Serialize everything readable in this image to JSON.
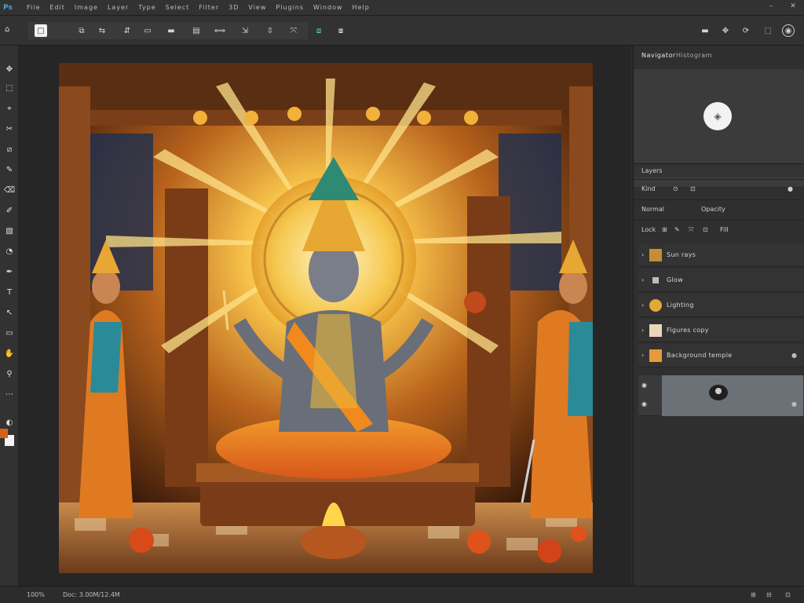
{
  "menubar": {
    "logo": "Ps",
    "items": [
      "File",
      "Edit",
      "Image",
      "Layer",
      "Type",
      "Select",
      "Filter",
      "3D",
      "View",
      "Plugins",
      "Window",
      "Help"
    ],
    "controls": [
      "–",
      "✕"
    ]
  },
  "optionsbar": {
    "preset_icon": "move-tool-icon",
    "buttons": [
      "▢",
      "⧉",
      "⇆",
      "⇵",
      "▭",
      "▬",
      "▤",
      "⟺",
      "⇲",
      "⇳",
      "⤧",
      "⧈"
    ],
    "right_buttons": [
      "▬",
      "✥",
      "⟳",
      "◉"
    ]
  },
  "toolbar": {
    "tools": [
      "✥",
      "⬚",
      "⌖",
      "✂",
      "⧄",
      "✎",
      "⌫",
      "✐",
      "▧",
      "◔",
      "✒",
      "T",
      "↖",
      "▭",
      "✋",
      "⚲",
      "⋯"
    ]
  },
  "panels": {
    "tabs": [
      "Navigator",
      "Histogram"
    ],
    "layers_header": "Layers",
    "layers_toolbar": [
      "Kind",
      "⊙",
      "⊡"
    ],
    "blend": {
      "mode": "Normal",
      "opacity": "Opacity"
    },
    "lock_row": [
      "Lock",
      "⊞",
      "✎",
      "⤧",
      "⊡",
      "Fill"
    ],
    "layers": [
      {
        "name": "Sun rays"
      },
      {
        "name": "Glow"
      },
      {
        "name": "Lighting"
      },
      {
        "name": "Figures copy"
      },
      {
        "name": "Background temple"
      }
    ]
  },
  "statusbar": {
    "zoom": "100%",
    "info": "Doc: 3.00M/12.4M",
    "right_icons": [
      "⊞",
      "⊟",
      "⊡"
    ]
  },
  "colors": {
    "foreground": "#d4611a",
    "background": "#f3f3f3"
  }
}
